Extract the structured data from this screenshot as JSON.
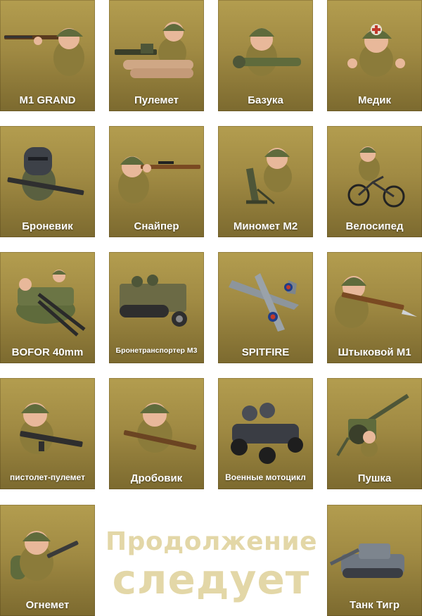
{
  "cards": [
    {
      "label": "M1 GRAND",
      "icon": "m1-garand-soldier-icon"
    },
    {
      "label": "Пулемет",
      "icon": "machine-gun-soldier-icon"
    },
    {
      "label": "Базука",
      "icon": "bazooka-soldier-icon"
    },
    {
      "label": "Медик",
      "icon": "medic-soldier-icon"
    },
    {
      "label": "Броневик",
      "icon": "armored-soldier-icon"
    },
    {
      "label": "Снайпер",
      "icon": "sniper-soldier-icon"
    },
    {
      "label": "Миномет М2",
      "icon": "mortar-soldier-icon"
    },
    {
      "label": "Велосипед",
      "icon": "bicycle-soldier-icon"
    },
    {
      "label": "BOFOR 40mm",
      "icon": "bofors-gun-icon"
    },
    {
      "label": "Бронетранспортер М3",
      "icon": "halftrack-icon"
    },
    {
      "label": "SPITFIRE",
      "icon": "spitfire-plane-icon"
    },
    {
      "label": "Штыковой М1",
      "icon": "bayonet-soldier-icon"
    },
    {
      "label": "пистолет-пулемет",
      "icon": "submachine-gun-soldier-icon"
    },
    {
      "label": "Дробовик",
      "icon": "shotgun-soldier-icon"
    },
    {
      "label": "Военные мотоцикл",
      "icon": "sidecar-motorcycle-icon"
    },
    {
      "label": "Пушка",
      "icon": "field-cannon-icon"
    },
    {
      "label": "Огнемет",
      "icon": "flamethrower-soldier-icon"
    },
    {
      "label": "Танк Тигр",
      "icon": "tiger-tank-icon"
    }
  ],
  "continue": {
    "line1": "Продолжение",
    "line2": "следует"
  },
  "colors": {
    "card_top": "#b39d4f",
    "card_bottom": "#7c6a2f",
    "helmet": "#5f6b3c",
    "uniform": "#8b7b3a",
    "skin": "#e8b89a",
    "continue_text": "#e3d7a7"
  }
}
